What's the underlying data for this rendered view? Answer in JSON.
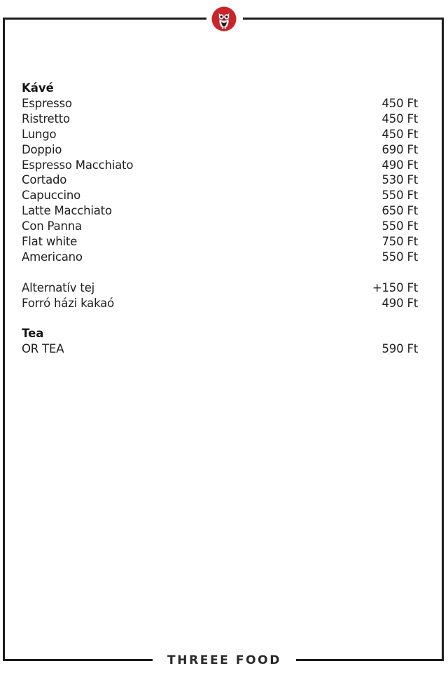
{
  "brand": {
    "name": "THREEE FOOD",
    "logo_icon": "owl-icon",
    "accent_color": "#c8262b",
    "frame_color": "#1c1c1c"
  },
  "sections": [
    {
      "title": "Kávé",
      "items": [
        {
          "name": "Espresso",
          "price": "450 Ft"
        },
        {
          "name": "Ristretto",
          "price": "450 Ft"
        },
        {
          "name": "Lungo",
          "price": "450 Ft"
        },
        {
          "name": "Doppio",
          "price": "690 Ft"
        },
        {
          "name": "Espresso Macchiato",
          "price": "490 Ft"
        },
        {
          "name": "Cortado",
          "price": "530 Ft"
        },
        {
          "name": "Capuccino",
          "price": "550 Ft"
        },
        {
          "name": "Latte Macchiato",
          "price": "650 Ft"
        },
        {
          "name": "Con Panna",
          "price": "550 Ft"
        },
        {
          "name": "Flat white",
          "price": "750 Ft"
        },
        {
          "name": "Americano",
          "price": "550 Ft"
        }
      ],
      "extras": [
        {
          "name": "Alternatív tej",
          "price": "+150 Ft"
        },
        {
          "name": "Forró házi kakaó",
          "price": "490 Ft"
        }
      ]
    },
    {
      "title": "Tea",
      "items": [
        {
          "name": "OR TEA",
          "price": "590 Ft"
        }
      ]
    }
  ]
}
